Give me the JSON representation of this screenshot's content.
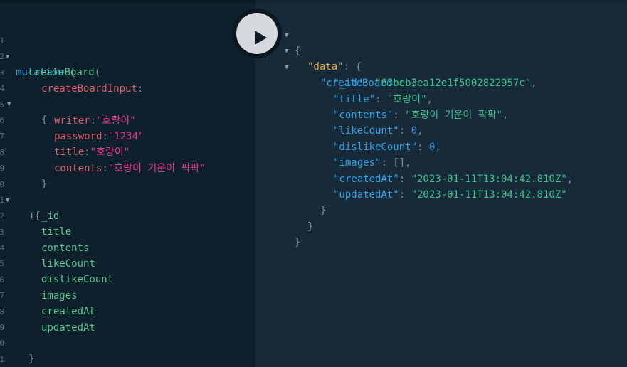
{
  "editor": {
    "line_numbers": [
      "1",
      "2",
      "3",
      "4",
      "5",
      "6",
      "7",
      "8",
      "9",
      "0",
      "1",
      "2",
      "3",
      "4",
      "5",
      "6",
      "7",
      "8",
      "9",
      "0",
      "1"
    ],
    "fold_marker": "▼",
    "query": {
      "keyword": "mutation",
      "open_brace": "{",
      "operation": "createBoard",
      "open_paren": "(",
      "input_arg": "createBoardInput",
      "colon": ":",
      "input_open": "{",
      "args": [
        {
          "name": "writer",
          "colon": ":",
          "value": "\"호랑이\""
        },
        {
          "name": "password",
          "colon": ":",
          "value": "\"1234\""
        },
        {
          "name": "title",
          "colon": ":",
          "value": "\"호랑이\""
        },
        {
          "name": "contents",
          "colon": ":",
          "value": "\"호랑이 기운이 팍팍\""
        }
      ],
      "input_close": "}",
      "selection_open": "){",
      "fields": [
        "_id",
        "title",
        "contents",
        "likeCount",
        "dislikeCount",
        "images",
        "createdAt",
        "updatedAt"
      ],
      "selection_close": "}",
      "close_brace": "}"
    }
  },
  "run_button": {
    "icon": "play-icon"
  },
  "result": {
    "fold_marker": "▼",
    "open_brace": "{",
    "data_key": "\"data\"",
    "colon": ": ",
    "data_open": "{",
    "create_key": "\"createBoard\"",
    "create_open": "{",
    "fields": [
      {
        "key": "\"_id\"",
        "value": "\"63beb3ea12e1f5002822957c\"",
        "type": "str",
        "comma": ","
      },
      {
        "key": "\"title\"",
        "value": "\"호랑이\"",
        "type": "str",
        "comma": ","
      },
      {
        "key": "\"contents\"",
        "value": "\"호랑이 기운이 팍팍\"",
        "type": "str",
        "comma": ","
      },
      {
        "key": "\"likeCount\"",
        "value": "0",
        "type": "num",
        "comma": ","
      },
      {
        "key": "\"dislikeCount\"",
        "value": "0",
        "type": "num",
        "comma": ","
      },
      {
        "key": "\"images\"",
        "value": "[]",
        "type": "punc",
        "comma": ","
      },
      {
        "key": "\"createdAt\"",
        "value": "\"2023-01-11T13:04:42.810Z\"",
        "type": "str",
        "comma": ","
      },
      {
        "key": "\"updatedAt\"",
        "value": "\"2023-01-11T13:04:42.810Z\"",
        "type": "str",
        "comma": ""
      }
    ],
    "create_close": "}",
    "data_close": "}",
    "close_brace": "}"
  },
  "colors": {
    "editor_bg": "#0f202d",
    "result_bg": "#172a3a",
    "keyword": "#2ea4e8",
    "field": "#4fc78f",
    "argument": "#e05c68",
    "string": "#e8398f",
    "result_key": "#2ea4e8",
    "result_data_key": "#e8a93d",
    "result_string": "#39c28a",
    "result_number": "#2f88d8"
  }
}
